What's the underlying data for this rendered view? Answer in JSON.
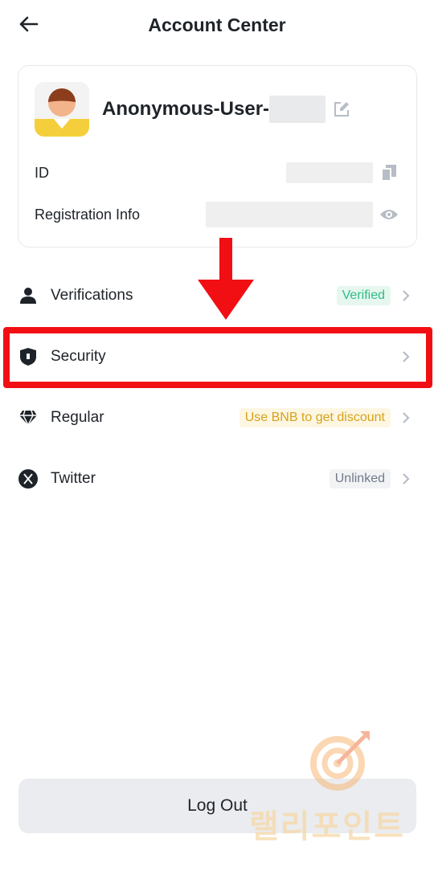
{
  "header": {
    "title": "Account Center"
  },
  "profile": {
    "username_prefix": "Anonymous-User-",
    "id_label": "ID",
    "registration_label": "Registration Info"
  },
  "menu": [
    {
      "label": "Verifications",
      "badge": "Verified",
      "icon": "person-icon",
      "badge_style": "green"
    },
    {
      "label": "Security",
      "badge": "",
      "icon": "shield-lock-icon"
    },
    {
      "label": "Regular",
      "badge": "Use BNB to get discount",
      "icon": "diamond-icon",
      "badge_style": "yellow"
    },
    {
      "label": "Twitter",
      "badge": "Unlinked",
      "icon": "x-logo-icon",
      "badge_style": "gray"
    }
  ],
  "logout": {
    "label": "Log Out"
  },
  "watermark": {
    "text": "랠리포인트"
  },
  "colors": {
    "highlight": "#f10f14",
    "verified_green": "#2ebd85",
    "bnb_yellow": "#d6a21a"
  }
}
